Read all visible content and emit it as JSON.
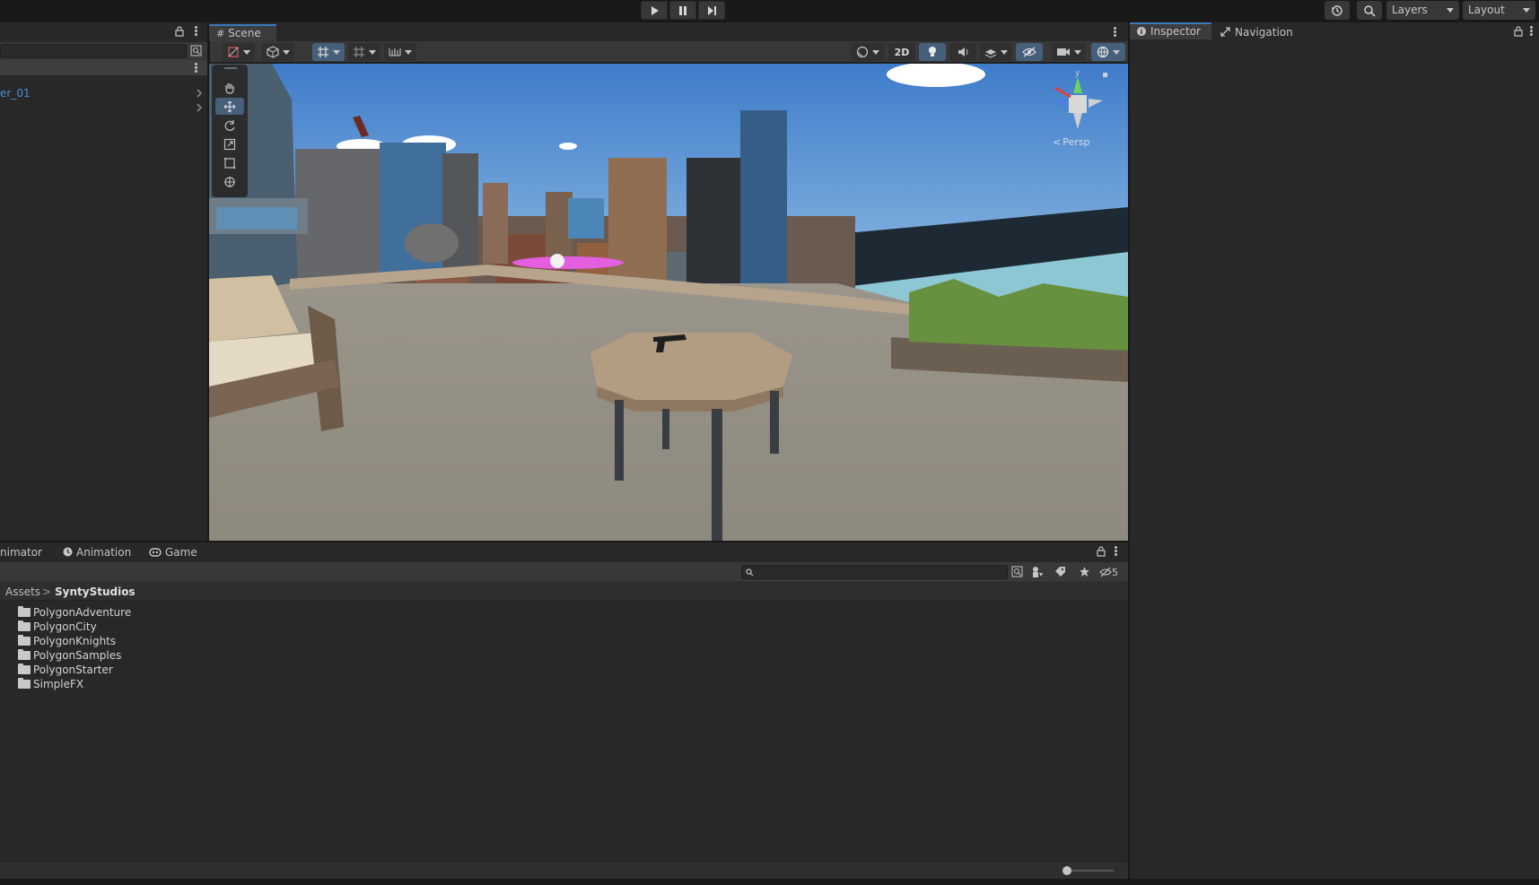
{
  "toolbar": {
    "play_icon": "play-icon",
    "pause_icon": "pause-icon",
    "step_icon": "step-icon",
    "history_icon": "history-icon",
    "search_icon": "search-icon",
    "layers_label": "Layers",
    "layout_label": "Layout"
  },
  "hierarchy": {
    "item_label": "er_01"
  },
  "scene": {
    "tab_label": "Scene",
    "button_2d": "2D",
    "gizmo_axis_y": "y",
    "persp_label": "Persp"
  },
  "inspector": {
    "tab_inspector": "Inspector",
    "tab_navigation": "Navigation"
  },
  "bottom": {
    "tab_animator": "nimator",
    "tab_animation": "Animation",
    "tab_game": "Game",
    "search_placeholder": "",
    "hidden_count": "5",
    "breadcrumb_root": "Assets",
    "breadcrumb_sep": ">",
    "breadcrumb_current": "SyntyStudios",
    "folders": [
      "PolygonAdventure",
      "PolygonCity",
      "PolygonKnights",
      "PolygonSamples",
      "PolygonStarter",
      "SimpleFX"
    ]
  },
  "colors": {
    "accent": "#3a79bb",
    "panel_bg": "#282828",
    "toolbar_bg": "#191919",
    "hierarchy_link": "#4a8fd8"
  }
}
